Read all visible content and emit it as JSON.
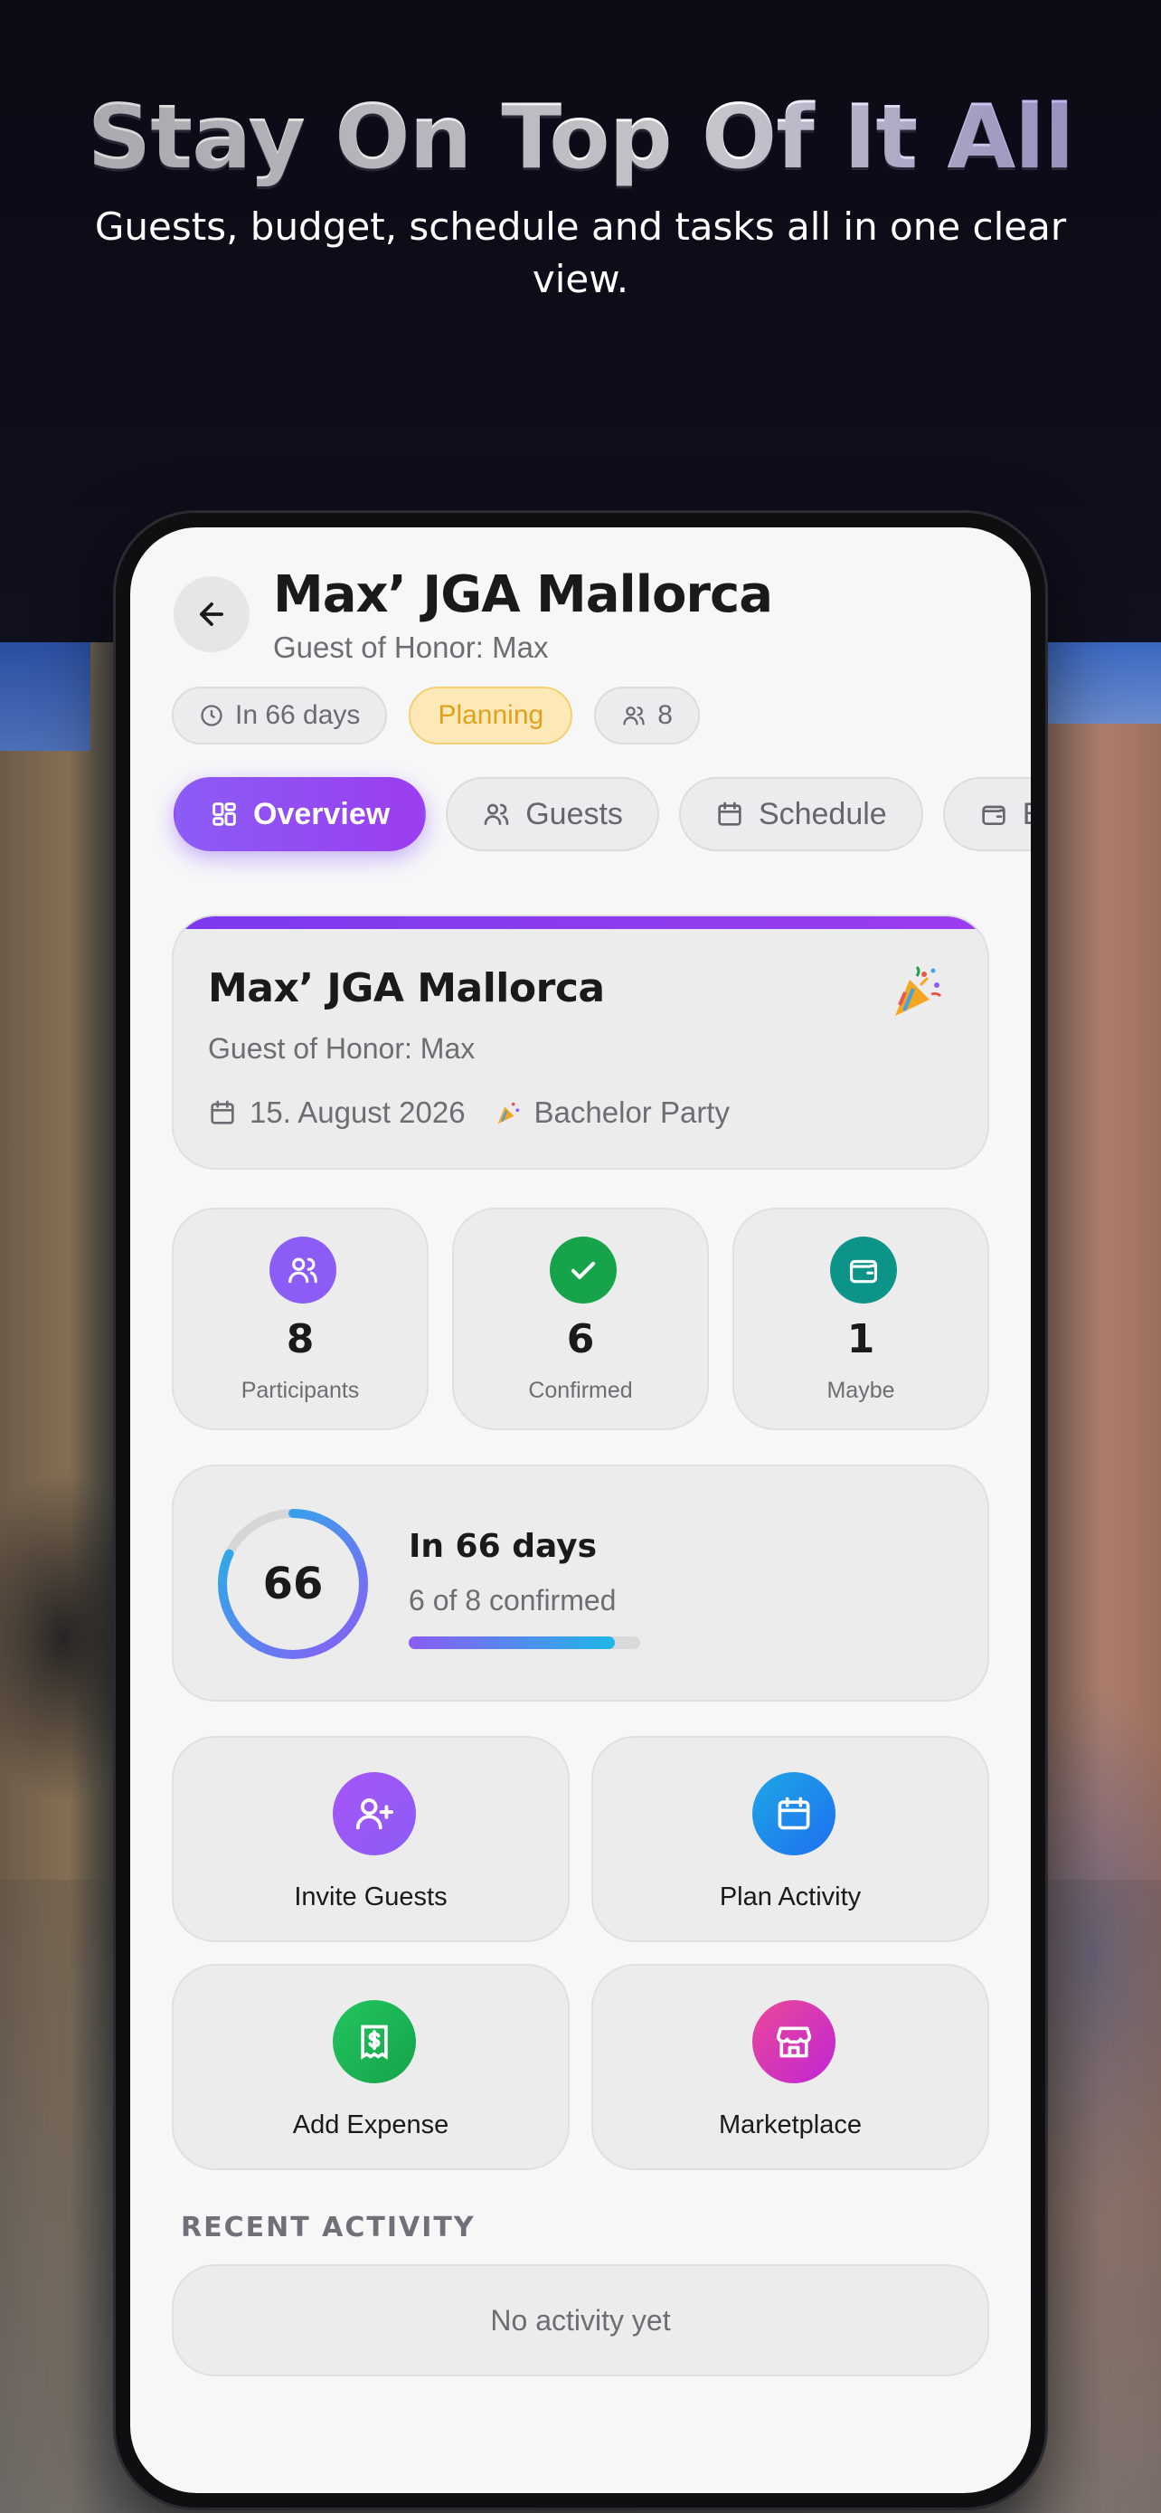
{
  "promo": {
    "title": "Stay On Top Of It All",
    "subtitle": "Guests, budget, schedule and tasks all in one clear view."
  },
  "event": {
    "title": "Max’ JGA Mallorca",
    "guest_of_honor": "Guest of Honor: Max",
    "date": "15. August 2026",
    "type": "Bachelor Party"
  },
  "chips": {
    "countdown": "In 66 days",
    "status": "Planning",
    "participants": "8"
  },
  "tabs": [
    "Overview",
    "Guests",
    "Schedule",
    "Ex"
  ],
  "stats": [
    {
      "value": "8",
      "label": "Participants",
      "color": "#8b5cf6"
    },
    {
      "value": "6",
      "label": "Confirmed",
      "color": "#16a34a"
    },
    {
      "value": "1",
      "label": "Maybe",
      "color": "#0d9488"
    }
  ],
  "countdown": {
    "days": "66",
    "title": "In 66 days",
    "subtitle": "6 of 8 confirmed",
    "progress": 0.89
  },
  "actions": [
    {
      "label": "Invite Guests",
      "icon": "user-plus-icon",
      "color": "#8b5cf6"
    },
    {
      "label": "Plan Activity",
      "icon": "calendar-icon",
      "color": "#1d8ff0"
    },
    {
      "label": "Add Expense",
      "icon": "receipt-icon",
      "color": "#16a34a"
    },
    {
      "label": "Marketplace",
      "icon": "store-icon",
      "color": "#db2777"
    }
  ],
  "recent": {
    "label": "RECENT ACTIVITY",
    "empty": "No activity yet"
  },
  "colors": {
    "accent": "#8b5cf6",
    "planning_bg": "#fde9b8",
    "planning_text": "#e0a11c"
  }
}
